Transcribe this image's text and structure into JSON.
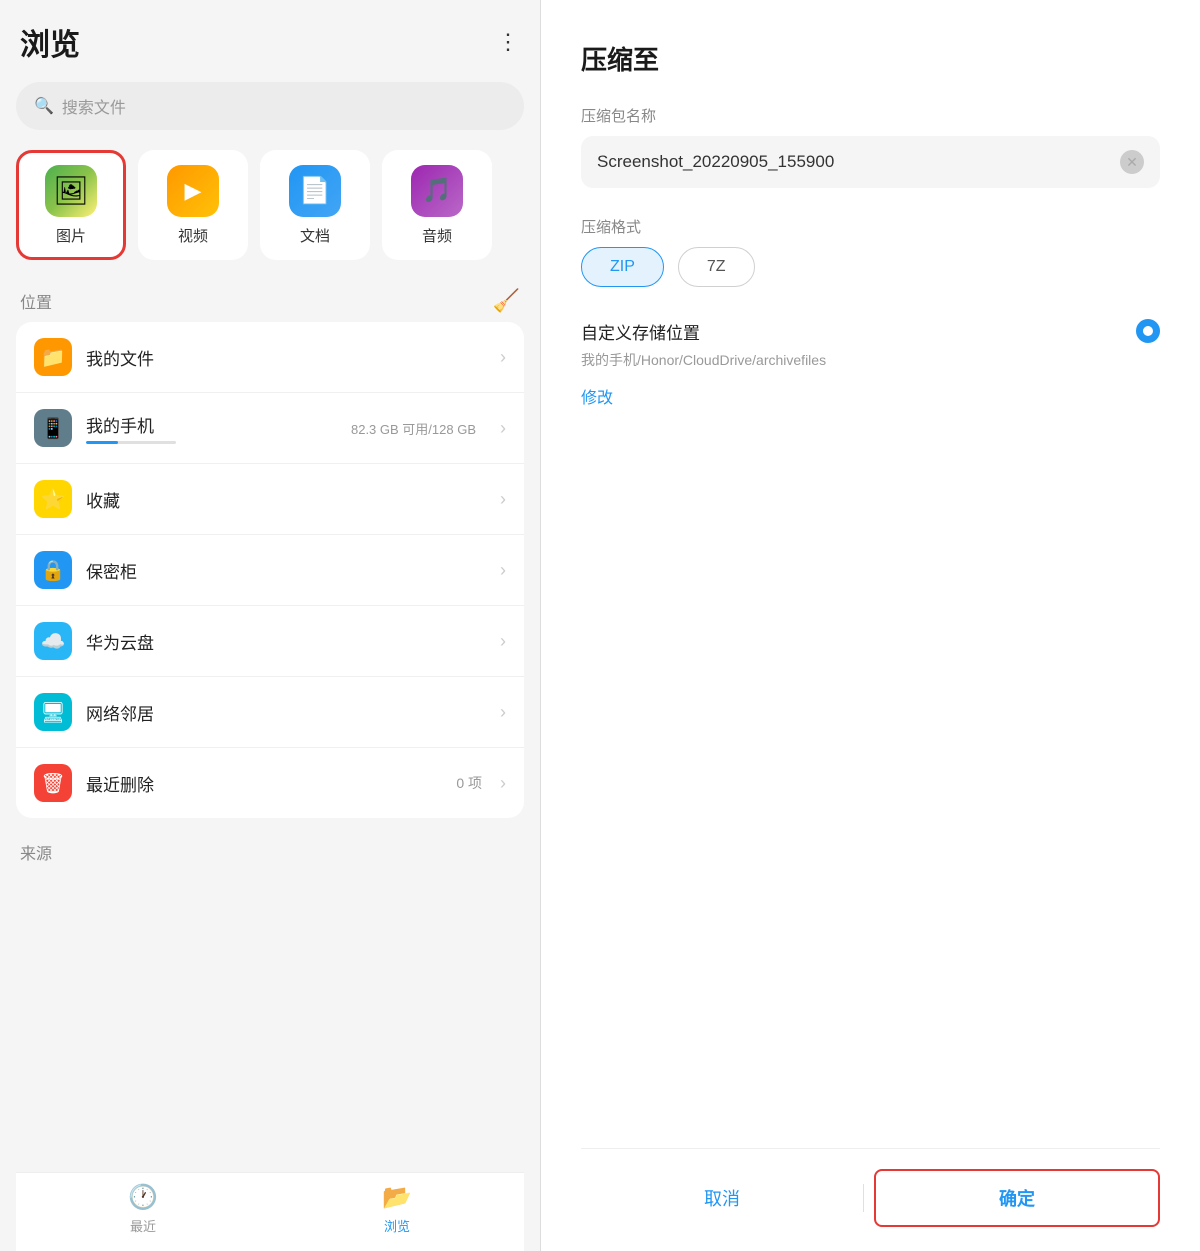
{
  "left": {
    "title": "浏览",
    "search_placeholder": "搜索文件",
    "categories": [
      {
        "id": "images",
        "label": "图片",
        "selected": true
      },
      {
        "id": "video",
        "label": "视频",
        "selected": false
      },
      {
        "id": "doc",
        "label": "文档",
        "selected": false
      },
      {
        "id": "music",
        "label": "音频",
        "selected": false
      }
    ],
    "location_section": "位置",
    "locations": [
      {
        "id": "myfiles",
        "name": "我的文件",
        "detail": "",
        "count": "",
        "icon": "folder"
      },
      {
        "id": "myphone",
        "name": "我的手机",
        "detail": "82.3 GB 可用/128 GB",
        "count": "",
        "icon": "phone"
      },
      {
        "id": "favorites",
        "name": "收藏",
        "detail": "",
        "count": "",
        "icon": "star"
      },
      {
        "id": "safe",
        "name": "保密柜",
        "detail": "",
        "count": "",
        "icon": "lock"
      },
      {
        "id": "huaweicloud",
        "name": "华为云盘",
        "detail": "",
        "count": "",
        "icon": "cloud"
      },
      {
        "id": "network",
        "name": "网络邻居",
        "detail": "",
        "count": "",
        "icon": "network"
      },
      {
        "id": "trash",
        "name": "最近删除",
        "detail": "",
        "count": "0 项",
        "icon": "trash"
      }
    ],
    "source_section": "来源",
    "tabs": [
      {
        "id": "recent",
        "label": "最近",
        "active": false
      },
      {
        "id": "browse",
        "label": "浏览",
        "active": true
      }
    ]
  },
  "right": {
    "title": "压缩至",
    "archive_name_label": "压缩包名称",
    "archive_name_value": "Screenshot_20220905_155900",
    "format_label": "压缩格式",
    "formats": [
      {
        "id": "zip",
        "label": "ZIP",
        "selected": true
      },
      {
        "id": "7z",
        "label": "7Z",
        "selected": false
      }
    ],
    "custom_storage_label": "自定义存储位置",
    "storage_path": "我的手机/Honor/CloudDrive/archivefiles",
    "modify_label": "修改",
    "cancel_label": "取消",
    "confirm_label": "确定"
  }
}
